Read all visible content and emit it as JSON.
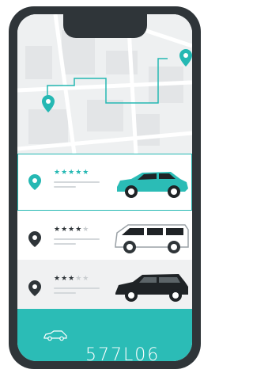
{
  "colors": {
    "accent": "#2bbcb6",
    "frame": "#2f3539",
    "map": "#eef0f1"
  },
  "rides": [
    {
      "icon": "suv-icon",
      "stars_filled": 5,
      "stars_total": 5,
      "selected": true,
      "stars_text": "★★★★★",
      "car_color": "#2bbcb6"
    },
    {
      "icon": "van-icon",
      "stars_filled": 4,
      "stars_total": 5,
      "selected": false,
      "stars_text": "★★★★",
      "stars_empty_text": "★",
      "car_color": "#ffffff"
    },
    {
      "icon": "suv-icon",
      "stars_filled": 3,
      "stars_total": 5,
      "selected": false,
      "stars_text": "★★★",
      "stars_empty_text": "★★",
      "car_color": "#1f2326"
    }
  ],
  "footer": {
    "icon": "car-outline-icon",
    "price": "577L06"
  }
}
